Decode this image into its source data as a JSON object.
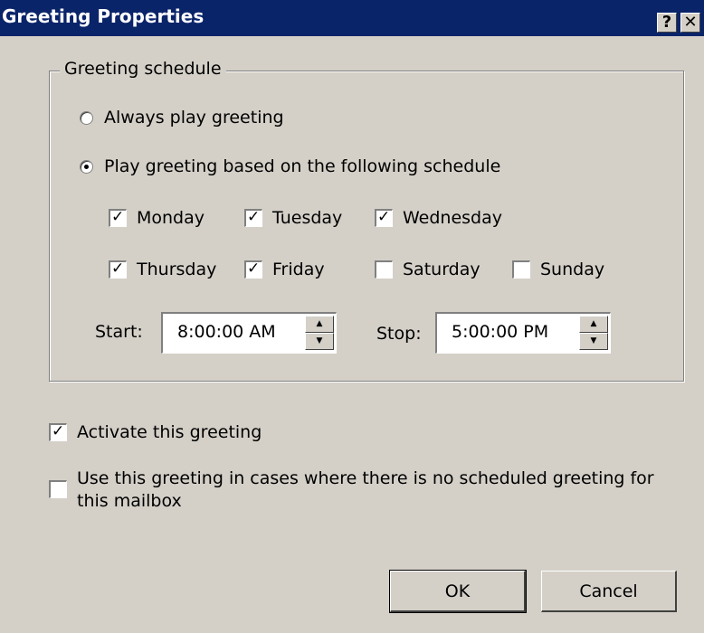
{
  "window": {
    "title": "Greeting Properties",
    "help_label": "?",
    "close_label": "✕"
  },
  "schedule_group": {
    "legend": "Greeting schedule",
    "options": [
      {
        "label": "Always play greeting",
        "selected": false
      },
      {
        "label": "Play greeting based on the following schedule",
        "selected": true
      }
    ],
    "days": [
      {
        "label": "Monday",
        "checked": true
      },
      {
        "label": "Tuesday",
        "checked": true
      },
      {
        "label": "Wednesday",
        "checked": true
      },
      {
        "label": "Thursday",
        "checked": true
      },
      {
        "label": "Friday",
        "checked": true
      },
      {
        "label": "Saturday",
        "checked": false
      },
      {
        "label": "Sunday",
        "checked": false
      }
    ],
    "start_label": "Start:",
    "start_value": "8:00:00 AM",
    "stop_label": "Stop:",
    "stop_value": "5:00:00 PM"
  },
  "options": {
    "activate_label": "Activate this greeting",
    "activate_checked": true,
    "default_label": "Use this greeting in cases where there is no scheduled greeting for this mailbox",
    "default_checked": false
  },
  "buttons": {
    "ok": "OK",
    "cancel": "Cancel"
  },
  "glyphs": {
    "check": "✓",
    "spin_up": "▲",
    "spin_down": "▼"
  },
  "colors": {
    "face": "#d4d0c8",
    "titlebar": "#0a246a"
  }
}
